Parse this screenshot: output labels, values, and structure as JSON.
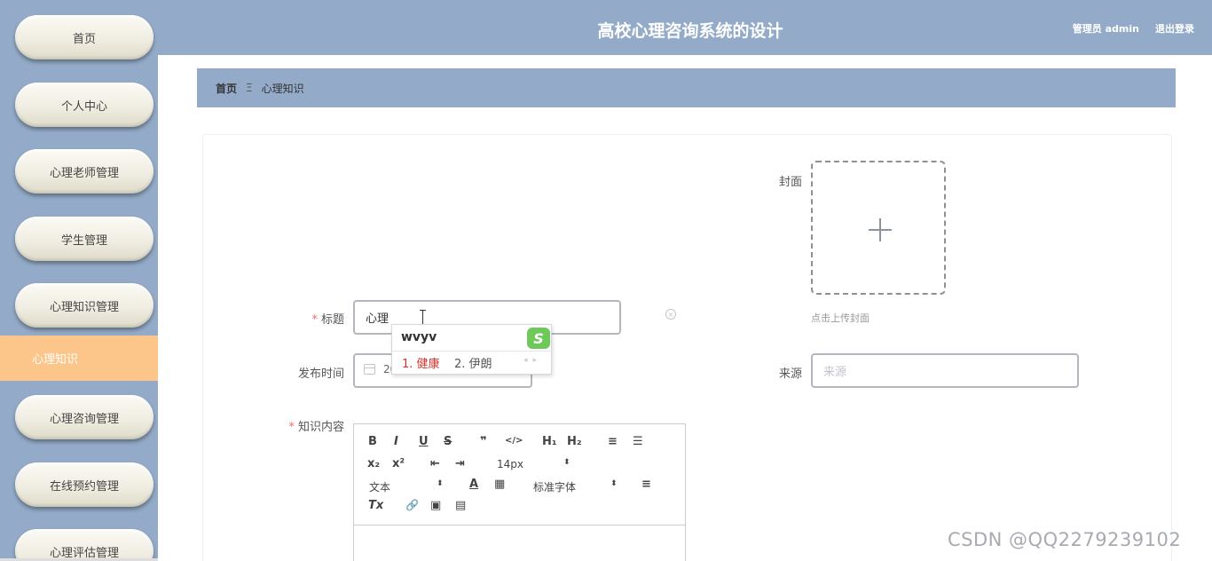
{
  "header": {
    "title": "高校心理咨询系统的设计",
    "user": "管理员 admin",
    "logout": "退出登录"
  },
  "sidebar": {
    "items": [
      {
        "label": "首页"
      },
      {
        "label": "个人中心"
      },
      {
        "label": "心理老师管理"
      },
      {
        "label": "学生管理"
      },
      {
        "label": "心理知识管理"
      },
      {
        "label": "心理知识",
        "active": true
      },
      {
        "label": "心理咨询管理"
      },
      {
        "label": "在线预约管理"
      },
      {
        "label": "心理评估管理"
      }
    ]
  },
  "breadcrumb": {
    "home": "首页",
    "separator": "Ξ",
    "current": "心理知识"
  },
  "form": {
    "cover_label": "封面",
    "cover_tip": "点击上传封面",
    "title_label": "标题",
    "title_value": "心理",
    "publish_time_label": "发布时间",
    "publish_time_value": "2023-04-10",
    "source_label": "来源",
    "source_placeholder": "来源",
    "content_label": "知识内容",
    "required_mark": "*"
  },
  "ime": {
    "input": "wvyv",
    "candidate_1": "1. 健康",
    "candidate_2": "2. 伊朗",
    "logo": "S"
  },
  "editor": {
    "toolbar_row1": [
      "B",
      "I",
      "U",
      "S",
      "❞",
      "</>",
      "H₁",
      "H₂",
      "≡",
      "☰"
    ],
    "toolbar_row2": [
      "x₂",
      "x²",
      "⇤",
      "⇥"
    ],
    "font_size": "14px",
    "block_format": "文本",
    "font_family": "标准字体",
    "select_arrow": "⬍",
    "icons_row3": [
      "A",
      "▦",
      "≡"
    ],
    "icons_row4": [
      "Tx",
      "🔗",
      "▣",
      "▤"
    ]
  },
  "watermark": "CSDN @QQ2279239102",
  "colors": {
    "primary": "#93abc8",
    "active_nav": "#fcc58a"
  }
}
